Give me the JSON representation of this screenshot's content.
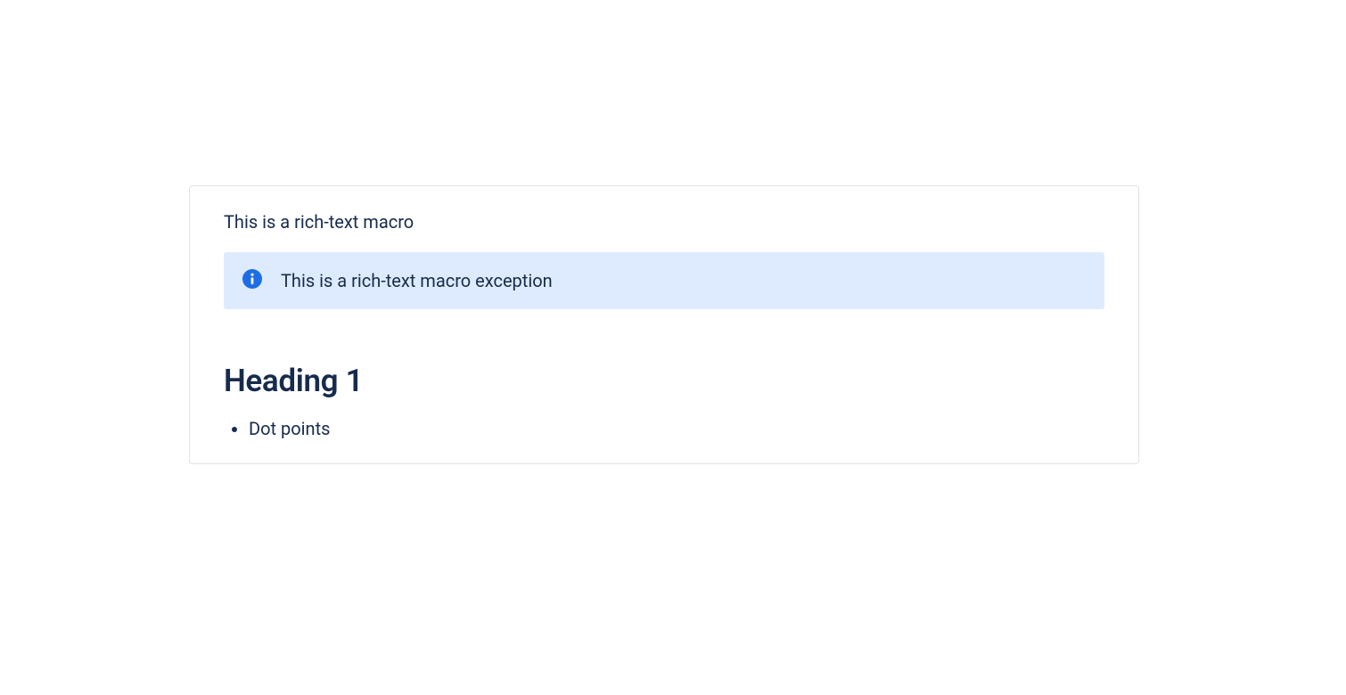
{
  "card": {
    "intro": "This is a rich-text macro",
    "panel": {
      "text": "This is a rich-text macro exception"
    },
    "heading": "Heading 1",
    "bullets": [
      "Dot points"
    ]
  }
}
